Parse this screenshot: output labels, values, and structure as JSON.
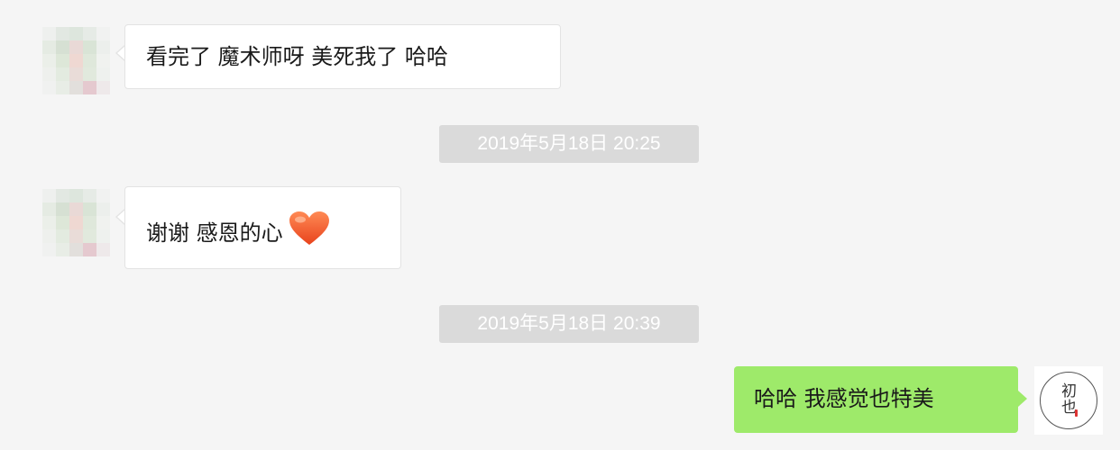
{
  "messages": [
    {
      "sender": "other",
      "text": "看完了 魔术师呀  美死我了  哈哈"
    },
    {
      "sender": "other",
      "text": "谢谢  感恩的心",
      "emoji": "heart-icon"
    },
    {
      "sender": "me",
      "text": "哈哈   我感觉也特美"
    }
  ],
  "timestamps": [
    "2019年5月18日 20:25",
    "2019年5月18日 20:39"
  ],
  "my_avatar": {
    "glyph_top": "初",
    "glyph_bottom": "也"
  },
  "colors": {
    "background": "#f5f5f5",
    "other_bubble": "#ffffff",
    "my_bubble": "#9eea6a",
    "timestamp_bg": "#dadada",
    "timestamp_text": "#ffffff",
    "heart": "#f0562b"
  }
}
